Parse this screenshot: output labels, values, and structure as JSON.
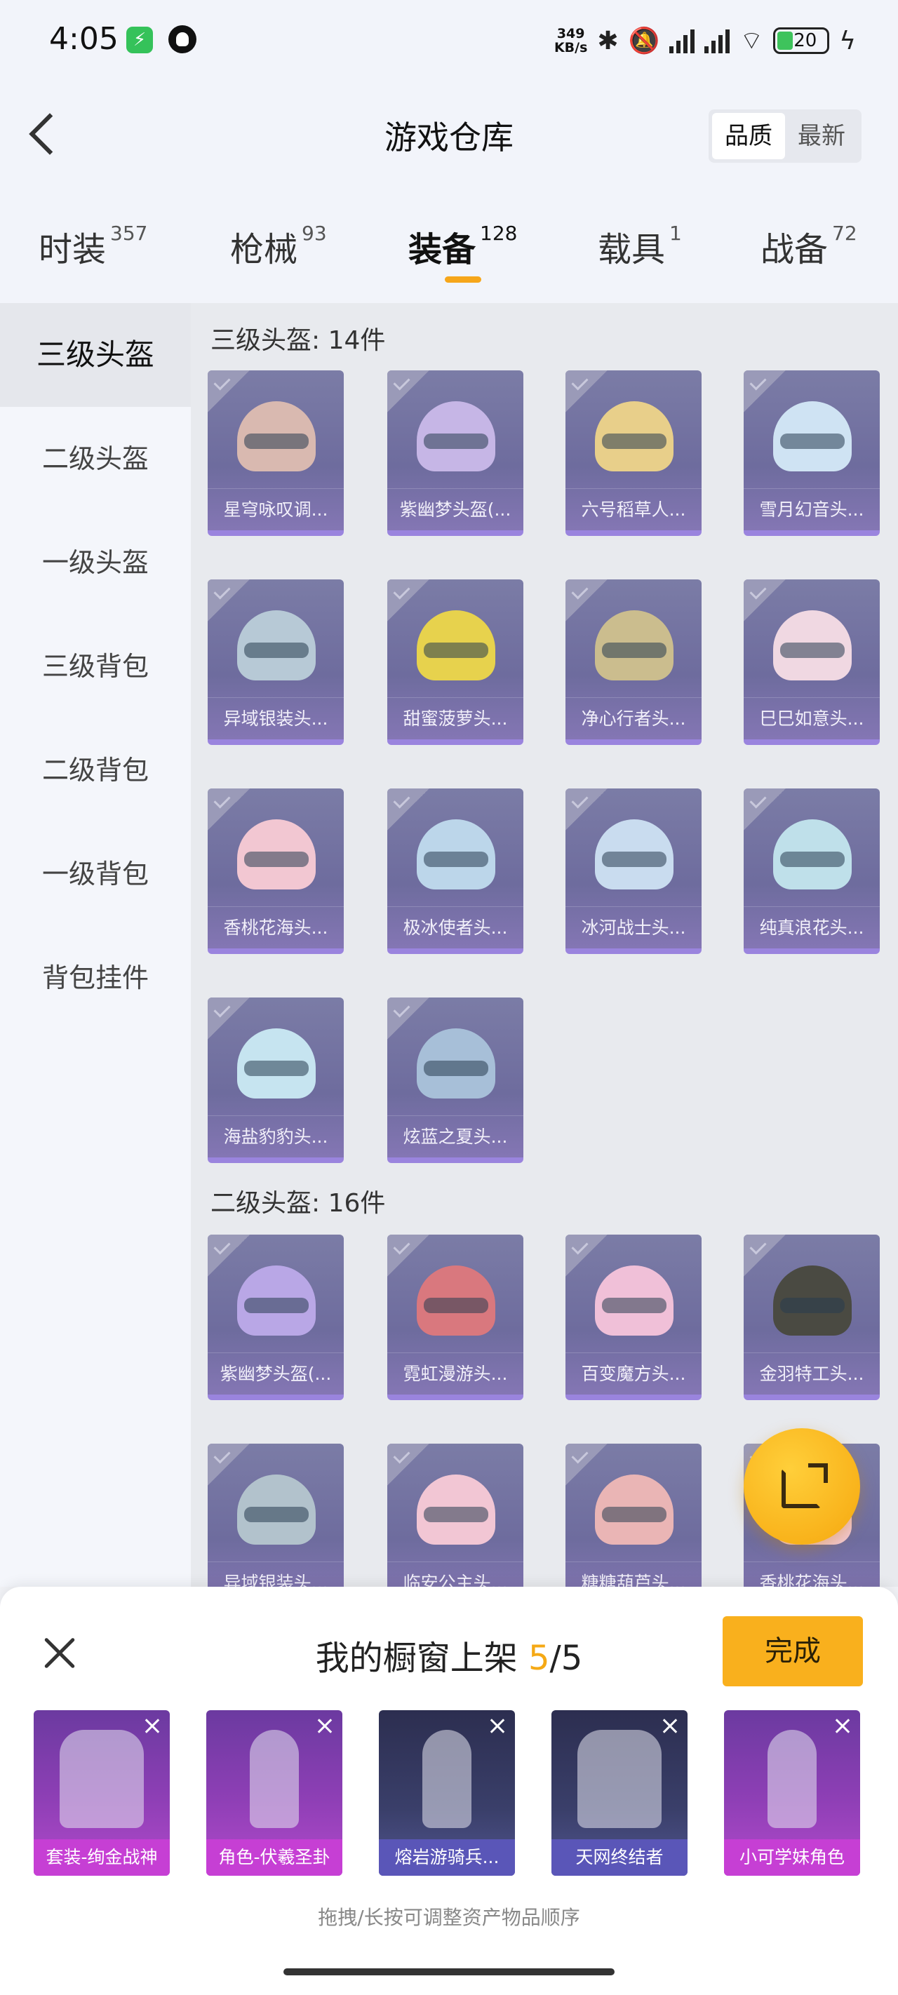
{
  "status_bar": {
    "time": "4:05",
    "net_speed_value": "349",
    "net_speed_unit": "KB/s",
    "battery": "20",
    "icons": [
      "wechat-charge-icon",
      "qq-icon",
      "bluetooth-icon",
      "mute-icon",
      "signal-hd-icon",
      "signal-hd-icon",
      "wifi-icon",
      "battery-icon",
      "charging-icon"
    ]
  },
  "header": {
    "title": "游戏仓库",
    "sort_options": [
      "品质",
      "最新"
    ],
    "sort_selected": "品质"
  },
  "tabs": [
    {
      "label": "时装",
      "count": "357"
    },
    {
      "label": "枪械",
      "count": "93"
    },
    {
      "label": "装备",
      "count": "128",
      "active": true
    },
    {
      "label": "载具",
      "count": "1"
    },
    {
      "label": "战备",
      "count": "72"
    }
  ],
  "sidebar": {
    "items": [
      {
        "label": "三级头盔",
        "active": true
      },
      {
        "label": "二级头盔"
      },
      {
        "label": "一级头盔"
      },
      {
        "label": "三级背包"
      },
      {
        "label": "二级背包"
      },
      {
        "label": "一级背包"
      },
      {
        "label": "背包挂件"
      }
    ]
  },
  "sections": [
    {
      "title": "三级头盔: 14件",
      "items": [
        {
          "name": "星穹咏叹调...",
          "color": "#d9b9b0"
        },
        {
          "name": "紫幽梦头盔(...",
          "color": "#c6b6e6"
        },
        {
          "name": "六号稻草人...",
          "color": "#e8cf8a"
        },
        {
          "name": "雪月幻音头...",
          "color": "#cfe3f3"
        },
        {
          "name": "异域银装头...",
          "color": "#b7c9d6"
        },
        {
          "name": "甜蜜菠萝头...",
          "color": "#e7d24d"
        },
        {
          "name": "净心行者头...",
          "color": "#cbbd8e"
        },
        {
          "name": "巳巳如意头...",
          "color": "#f0d8e2"
        },
        {
          "name": "香桃花海头...",
          "color": "#f2c7d2"
        },
        {
          "name": "极冰使者头...",
          "color": "#bcd6ea"
        },
        {
          "name": "冰河战士头...",
          "color": "#c9dcef"
        },
        {
          "name": "纯真浪花头...",
          "color": "#bfe0ea"
        },
        {
          "name": "海盐豹豹头...",
          "color": "#c6e4f0"
        },
        {
          "name": "炫蓝之夏头...",
          "color": "#a7bfd8"
        }
      ]
    },
    {
      "title": "二级头盔: 16件",
      "items": [
        {
          "name": "紫幽梦头盔(...",
          "color": "#b9a7e6"
        },
        {
          "name": "霓虹漫游头...",
          "color": "#d9787e"
        },
        {
          "name": "百变魔方头...",
          "color": "#f0c0d8"
        },
        {
          "name": "金羽特工头...",
          "color": "#4a4a42"
        },
        {
          "name": "异域银装头...",
          "color": "#b2c2cc"
        },
        {
          "name": "临安公主头...",
          "color": "#f2c6d4"
        },
        {
          "name": "糖糖葫芦头...",
          "color": "#eab5b5"
        },
        {
          "name": "香桃花海头...",
          "color": "#f2c7d2"
        }
      ]
    }
  ],
  "showcase": {
    "title_prefix": "我的橱窗上架",
    "current": "5",
    "total": "/5",
    "done_label": "完成",
    "items": [
      {
        "name": "套装-绚金战神"
      },
      {
        "name": "角色-伏羲圣卦"
      },
      {
        "name": "熔岩游骑兵..."
      },
      {
        "name": "天网终结者"
      },
      {
        "name": "小可学妹角色"
      }
    ],
    "hint": "拖拽/长按可调整资产物品顺序"
  }
}
